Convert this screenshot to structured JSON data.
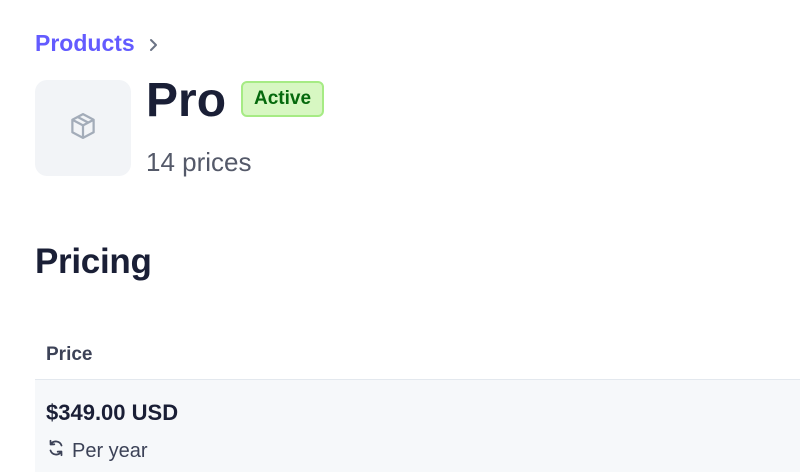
{
  "breadcrumb": {
    "parent_label": "Products"
  },
  "product": {
    "name": "Pro",
    "status": "Active",
    "price_count": "14 prices",
    "thumbnail_icon": "box-icon"
  },
  "pricing": {
    "section_title": "Pricing",
    "columns": [
      "Price"
    ],
    "rows": [
      {
        "amount": "$349.00 USD",
        "interval": "Per year",
        "interval_icon": "recurring-icon"
      }
    ]
  },
  "colors": {
    "accent": "#635bff",
    "badge_bg": "#d7f7c2",
    "badge_text": "#05690d",
    "row_bg": "#f6f8fa"
  }
}
